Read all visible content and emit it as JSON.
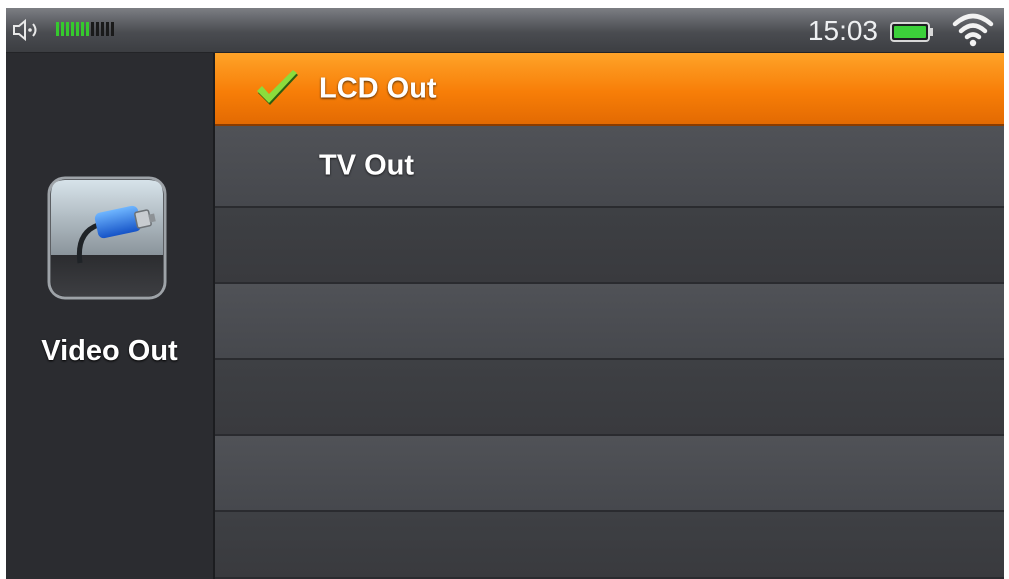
{
  "status_bar": {
    "time": "15:03",
    "volume_level_fraction": 0.55,
    "volume_segments": 12,
    "icons": [
      "speaker-icon",
      "battery-icon",
      "wifi-icon"
    ],
    "battery_color": "#3cd13a",
    "volume_on_color": "#36c92e",
    "volume_off_color": "#1a1a1a"
  },
  "left_panel": {
    "icon": "video-cable-icon",
    "label": "Video Out"
  },
  "menu": {
    "items": [
      {
        "label": "LCD Out",
        "selected": true
      },
      {
        "label": "TV Out",
        "selected": false
      },
      {
        "label": "",
        "selected": false
      },
      {
        "label": "",
        "selected": false
      },
      {
        "label": "",
        "selected": false
      },
      {
        "label": "",
        "selected": false
      },
      {
        "label": "",
        "selected": false
      }
    ],
    "selected_color": "#f77e08",
    "check_icon": "checkmark-icon",
    "check_color": "#7ed321"
  }
}
